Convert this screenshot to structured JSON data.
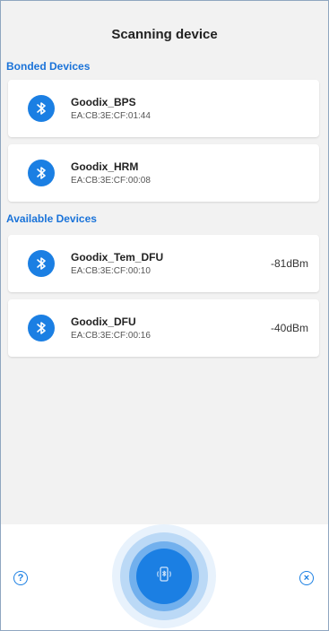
{
  "header": {
    "title": "Scanning device"
  },
  "sections": {
    "bonded_title": "Bonded Devices",
    "available_title": "Available Devices"
  },
  "bonded_devices": [
    {
      "name": "Goodix_BPS",
      "mac": "EA:CB:3E:CF:01:44"
    },
    {
      "name": "Goodix_HRM",
      "mac": "EA:CB:3E:CF:00:08"
    }
  ],
  "available_devices": [
    {
      "name": "Goodix_Tem_DFU",
      "mac": "EA:CB:3E:CF:00:10",
      "rssi": "-81dBm"
    },
    {
      "name": "Goodix_DFU",
      "mac": "EA:CB:3E:CF:00:16",
      "rssi": "-40dBm"
    }
  ],
  "bottom": {
    "help_glyph": "?",
    "close_glyph": "×"
  },
  "icons": {
    "device": "bluetooth-icon",
    "scan": "phone-bluetooth-icon",
    "help": "help-icon",
    "close": "close-icon"
  },
  "colors": {
    "accent": "#1b7fe3",
    "section_title": "#1a73d9",
    "background": "#f2f2f2"
  }
}
